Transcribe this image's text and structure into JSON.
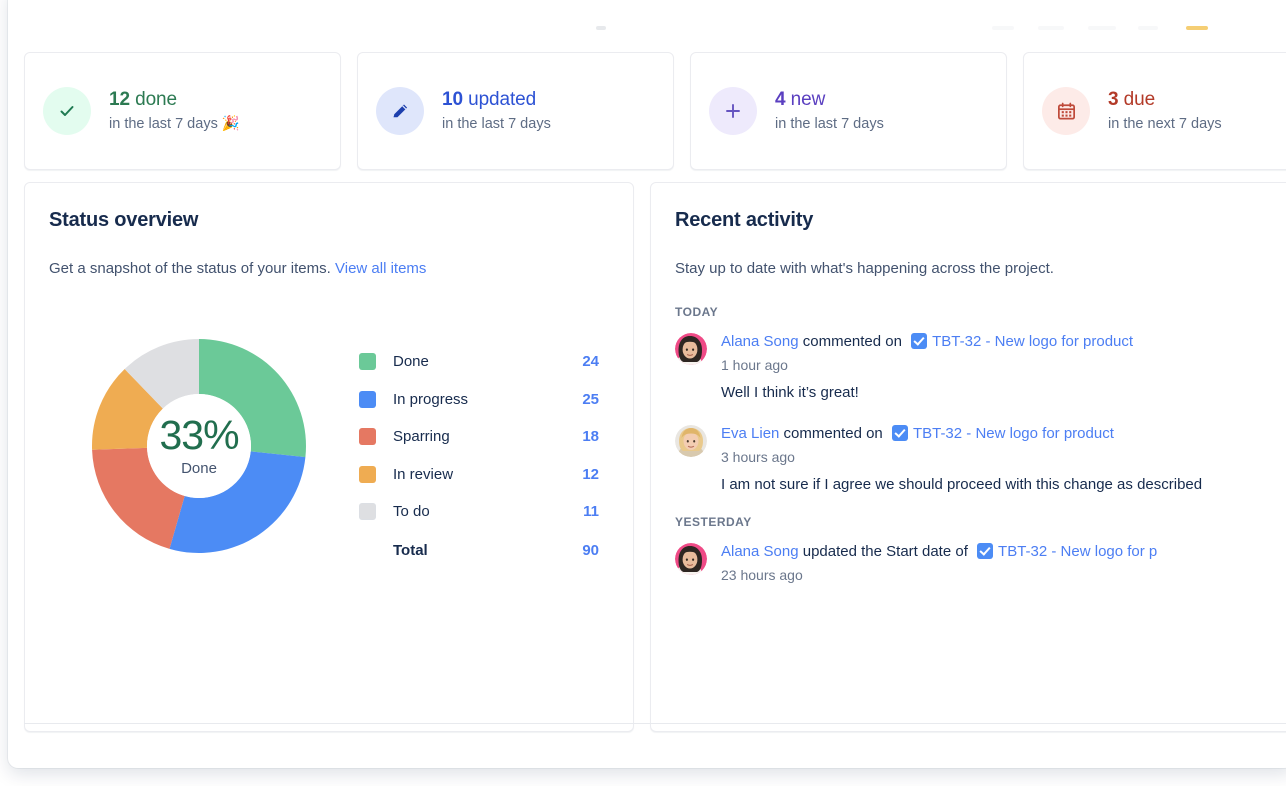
{
  "stats": [
    {
      "count": "12",
      "unit": "done",
      "sub": "in the last 7 days 🎉",
      "icon": "check-icon",
      "icon_bg": "#e3fcef",
      "icon_color": "#1f7a52",
      "text_color": "#2c7a52"
    },
    {
      "count": "10",
      "unit": "updated",
      "sub": "in the last 7 days",
      "icon": "pencil-icon",
      "icon_bg": "#dfe6fb",
      "icon_color": "#1d3fad",
      "text_color": "#2d52d4"
    },
    {
      "count": "4",
      "unit": "new",
      "sub": "in the last 7 days",
      "icon": "plus-icon",
      "icon_bg": "#eeeafc",
      "icon_color": "#6554c0",
      "text_color": "#5a3fc0"
    },
    {
      "count": "3",
      "unit": "due",
      "sub": "in the next 7 days",
      "icon": "calendar-icon",
      "icon_bg": "#fdebe8",
      "icon_color": "#bf4a3a",
      "text_color": "#b33a28"
    }
  ],
  "status_panel": {
    "title": "Status overview",
    "description": "Get a snapshot of the status of your items.",
    "link_label": "View all items",
    "center_percent": "33%",
    "center_label": "Done",
    "total_label": "Total",
    "total_value": "90"
  },
  "chart_data": {
    "type": "pie",
    "title": "Status overview",
    "subtype": "donut",
    "categories": [
      "Done",
      "In progress",
      "Sparring",
      "In review",
      "To do"
    ],
    "values": [
      24,
      25,
      18,
      12,
      11
    ],
    "colors": [
      "#6bc998",
      "#4c8cf5",
      "#e57862",
      "#efac52",
      "#dedfe2"
    ],
    "total": 90,
    "center_value": "33%",
    "center_label": "Done",
    "legend_position": "right",
    "legend_value_color": "#4c7ef3",
    "grid": false
  },
  "activity_panel": {
    "title": "Recent activity",
    "description": "Stay up to date with what's happening across the project.",
    "groups": [
      {
        "day": "TODAY",
        "items": [
          {
            "actor": "Alana Song",
            "action": "commented on",
            "issue": "TBT-32 - New logo for product",
            "issue_icon": "task-checkbox-icon",
            "time": "1 hour ago",
            "comment": "Well I think it’s great!",
            "avatar": "avatar-alana-song"
          },
          {
            "actor": "Eva Lien",
            "action": "commented on",
            "issue": "TBT-32 - New logo for product",
            "issue_icon": "task-checkbox-icon",
            "time": "3 hours ago",
            "comment": "I am not sure if I agree we should proceed with this change as described",
            "avatar": "avatar-eva-lien"
          }
        ]
      },
      {
        "day": "YESTERDAY",
        "items": [
          {
            "actor": "Alana Song",
            "action": "updated the Start date of",
            "issue": "TBT-32 - New logo for p",
            "issue_icon": "task-checkbox-icon",
            "time": "23 hours ago",
            "comment": "",
            "avatar": "avatar-alana-song"
          }
        ]
      }
    ]
  }
}
